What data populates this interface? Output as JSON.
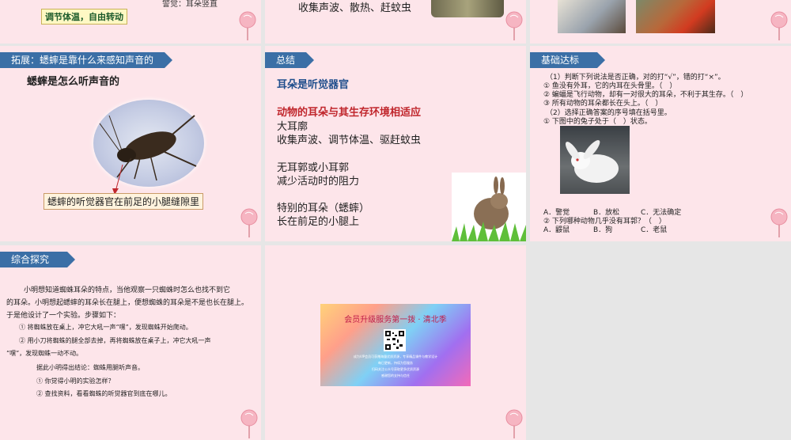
{
  "colors": {
    "banner": "#3b6fa6",
    "slide_bg": "#fde5ea",
    "accent_red": "#c0262c"
  },
  "slide1": {
    "badge": "调节体温，自由转动",
    "note": "警觉：耳朵竖直"
  },
  "slide2": {
    "line": "收集声波、散热、赶蚊虫"
  },
  "slide4": {
    "banner": "拓展：蟋蟀是靠什么来感知声音的",
    "heading": "蟋蟀是怎么听声音的",
    "caption": "蟋蟀的听觉器官在前足的小腿缝隙里"
  },
  "slide5": {
    "banner": "总结",
    "title": "耳朵是听觉器官",
    "red": "动物的耳朵与其生存环境相适应",
    "lines": [
      "大耳廓",
      "收集声波、调节体温、驱赶蚊虫",
      "无耳郭或小耳郭",
      "减少活动时的阻力",
      "特别的耳朵（蟋蟀）",
      "长在前足的小腿上"
    ]
  },
  "slide6": {
    "banner": "基础达标",
    "lines": [
      "（1）判断下列说法是否正确，对的打“√”，错的打“×”。",
      "① 鱼没有外耳，它的内耳在头骨里。（　）",
      "② 蝙蝠是飞行动物，却有一对很大的耳朵，不利于其生存。（　）",
      "③ 所有动物的耳朵都长在头上。（　）",
      "（2）选择正确答案的序号填在括号里。",
      "① 下图中的兔子处于（　）状态。"
    ],
    "opts1": [
      "A．警觉",
      "B．放松",
      "C．无法确定"
    ],
    "q2": "② 下列哪种动物几乎没有耳郭？（　）",
    "opts2": [
      "A．鼹鼠",
      "B．狗",
      "C．老鼠"
    ]
  },
  "slide7": {
    "banner": "综合探究",
    "lines": [
      "小明想知道蜘蛛耳朵的特点，当他观察一只蜘蛛时怎么也找不到它",
      "的耳朵。小明想起蟋蟀的耳朵长在腿上，便想蜘蛛的耳朵是不是也长在腿上。",
      "于是他设计了一个实验。步骤如下：",
      "① 将蜘蛛放在桌上，冲它大吼一声“嘿”，发现蜘蛛开始爬动。",
      "② 用小刀将蜘蛛的腿全部去掉，再将蜘蛛放在桌子上，冲它大吼一声",
      "“嘿”，发现蜘蛛一动不动。",
      "据此小明得出结论：蜘蛛用腿听声音。",
      "① 你觉得小明的实验怎样？",
      "② 查找资料，看看蜘蛛的听觉器官到底在哪儿。"
    ]
  },
  "slide8": {
    "title": "会员升级服务第一拨 · 清北季",
    "fine": [
      "成为VIP会员可获赠海量优质资源，专享精品课件与教学设计",
      "每日更新，持续为您服务",
      "扫码关注公众号获取更多优质资源",
      "感谢您的支持与信任"
    ]
  }
}
